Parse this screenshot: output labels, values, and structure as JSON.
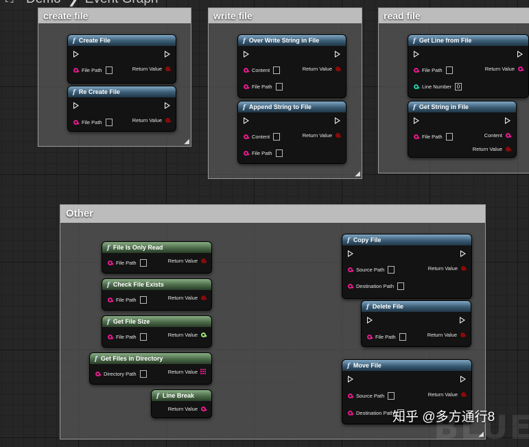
{
  "breadcrumb": {
    "root": "Demo",
    "current": "Event Graph"
  },
  "comments": {
    "create": "create file",
    "write": "write file",
    "read": "read file",
    "other": "Other"
  },
  "nodes": {
    "create_file": {
      "title": "Create File",
      "in1": "File Path",
      "out": "Return Value"
    },
    "re_create_file": {
      "title": "Re Create File",
      "in1": "File Path",
      "out": "Return Value"
    },
    "over_write": {
      "title": "Over Write String in File",
      "in1": "Content",
      "in2": "File Path",
      "out": "Return Value"
    },
    "append": {
      "title": "Append String to File",
      "in1": "Content",
      "in2": "File Path",
      "out": "Return Value"
    },
    "get_line": {
      "title": "Get Line from File",
      "in1": "File Path",
      "in2": "Line Number",
      "in2_value": "0",
      "out": "Return Value"
    },
    "get_string": {
      "title": "Get String in File",
      "in1": "File Path",
      "out1": "Content",
      "out2": "Return Value"
    },
    "only_read": {
      "title": "File Is Only Read",
      "in1": "File Path",
      "out": "Return Value"
    },
    "check_exists": {
      "title": "Check File Exists",
      "in1": "File Path",
      "out": "Return Value"
    },
    "get_size": {
      "title": "Get File Size",
      "in1": "File Path",
      "out": "Return Value"
    },
    "files_in_dir": {
      "title": "Get Files in Directory",
      "in1": "Directory Path",
      "out": "Return Value"
    },
    "line_break": {
      "title": "Line Break",
      "out": "Return Value"
    },
    "copy_file": {
      "title": "Copy File",
      "in1": "Source Path",
      "in2": "Destination Path",
      "out": "Return Value"
    },
    "delete_file": {
      "title": "Delete File",
      "in1": "File Path",
      "out": "Return Value"
    },
    "move_file": {
      "title": "Move File",
      "in1": "Source Path",
      "in2": "Destination Path",
      "out": "Return Value"
    }
  },
  "watermark": "知乎 @多方通行8",
  "background_text": "BLUE",
  "colors": {
    "function_header": "#3a5c74",
    "pure_header": "#4c6b49",
    "string_pin": "#e61a8d",
    "bool_pin": "#8a0a0a",
    "int_pin": "#23c9a5"
  }
}
